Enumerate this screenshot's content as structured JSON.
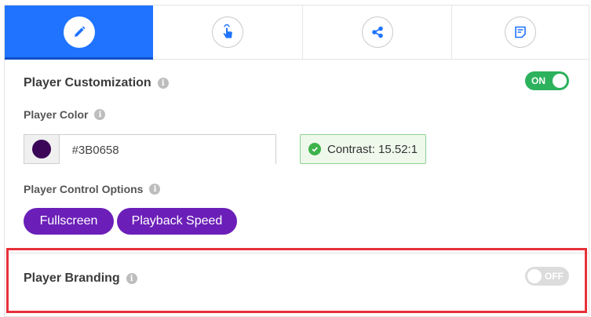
{
  "tabs": [
    {
      "icon": "pencil-icon",
      "active": true
    },
    {
      "icon": "tap-hand-icon",
      "active": false
    },
    {
      "icon": "share-icon",
      "active": false
    },
    {
      "icon": "note-icon",
      "active": false
    }
  ],
  "customization": {
    "title": "Player Customization",
    "toggle": {
      "state": "on",
      "label": "ON"
    },
    "color_label": "Player Color",
    "color_value": "#3B0658",
    "contrast_text": "Contrast: 15.52:1",
    "controls_label": "Player Control Options",
    "options": [
      "Fullscreen",
      "Playback Speed"
    ]
  },
  "branding": {
    "title": "Player Branding",
    "toggle": {
      "state": "off",
      "label": "OFF"
    }
  },
  "colors": {
    "tab_active": "#1F73FF",
    "toggle_on": "#2CB15D",
    "pill": "#6B1FB8",
    "swatch": "#3B0658",
    "highlight": "#E8313A"
  }
}
